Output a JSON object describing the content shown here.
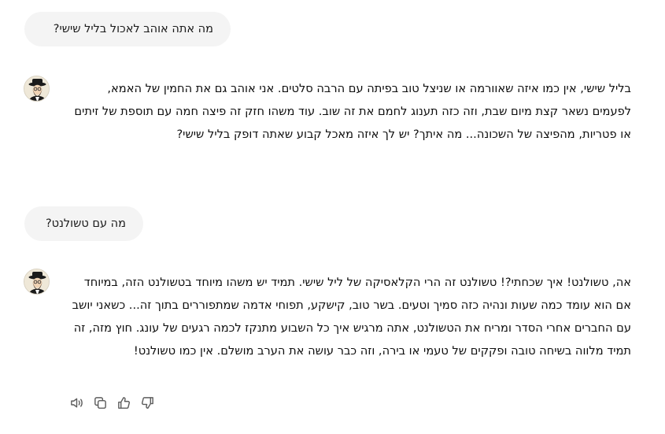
{
  "conversation": {
    "messages": [
      {
        "role": "user",
        "text": "מה אתה אוהב לאכול בליל שישי?"
      },
      {
        "role": "assistant",
        "text": "בליל שישי, אין כמו איזה שאוורמה או שניצל טוב בפיתה עם הרבה סלטים. אני אוהב גם את החמין של האמא, לפעמים נשאר קצת מיום שבת, וזה כזה תענוג לחמם את זה שוב. עוד משהו חזק זה פיצה חמה עם תוספת של זיתים או פטריות, מהפיצה של השכונה... מה איתך? יש לך איזה מאכל קבוע שאתה דופק בליל שישי?"
      },
      {
        "role": "user",
        "text": "מה עם טשולנט?"
      },
      {
        "role": "assistant",
        "text": "אה, טשולנט! איך שכחתי?! טשולנט זה הרי הקלאסיקה של ליל שישי. תמיד יש משהו מיוחד בטשולנט הזה, במיוחד אם הוא עומד כמה שעות ונהיה כזה סמיך וטעים. בשר טוב, קישקע, תפוחי אדמה שמתפוררים בתוך זה... כשאני יושב עם החברים אחרי הסדר ומריח את הטשולנט, אתה מרגיש איך כל השבוע מתנקז לכמה רגעים של עונג. חוץ מזה, זה תמיד מלווה בשיחה טובה ופקקים של טעמי או בירה, וזה כבר עושה את הערב מושלם. אין כמו טשולנט!"
      }
    ]
  },
  "actions": [
    {
      "icon": "speaker-icon"
    },
    {
      "icon": "copy-icon"
    },
    {
      "icon": "thumbs-up-icon"
    },
    {
      "icon": "thumbs-down-icon"
    }
  ],
  "colors": {
    "user_bubble_bg": "#f4f4f4",
    "text": "#0d0d0d",
    "icon": "#5d5d5d"
  }
}
